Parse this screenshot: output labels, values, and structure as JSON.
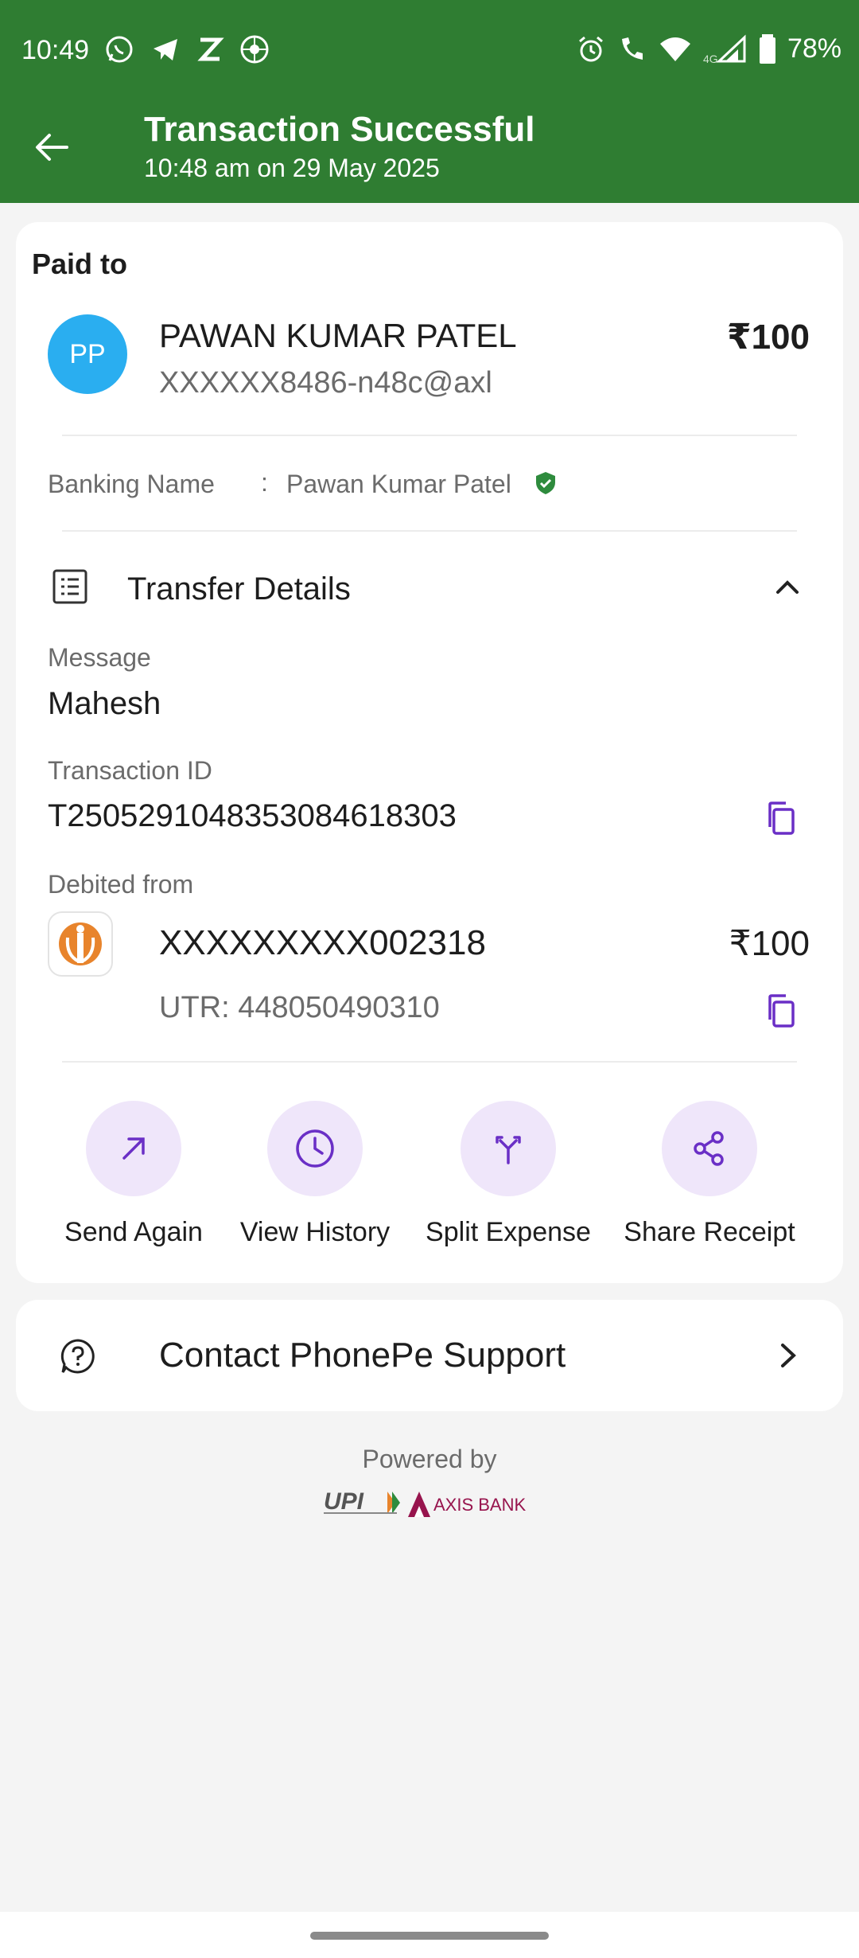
{
  "colors": {
    "header_green": "#2f7d32",
    "avatar_blue": "#2aaef0",
    "accent_purple": "#6a2fc6",
    "verified_green": "#2e8b3d"
  },
  "status_bar": {
    "time": "10:49",
    "battery": "78%",
    "network": "4G"
  },
  "header": {
    "title": "Transaction Successful",
    "subtitle": "10:48 am on 29 May 2025"
  },
  "paid_to": {
    "heading": "Paid to",
    "avatar_initials": "PP",
    "name": "PAWAN KUMAR PATEL",
    "upi_id": "XXXXXX8486-n48c@axl",
    "amount": "₹100",
    "banking_name_label": "Banking Name",
    "banking_name_sep": ":",
    "banking_name": "Pawan Kumar Patel"
  },
  "transfer_details": {
    "label": "Transfer Details",
    "message_label": "Message",
    "message": "Mahesh",
    "txn_id_label": "Transaction ID",
    "txn_id": "T2505291048353084618303",
    "debited_from_label": "Debited from",
    "account": "XXXXXXXXX002318",
    "account_amount": "₹100",
    "utr": "UTR: 448050490310"
  },
  "actions": [
    {
      "label": "Send Again",
      "icon": "arrow-up-right-icon"
    },
    {
      "label": "View History",
      "icon": "clock-icon"
    },
    {
      "label": "Split Expense",
      "icon": "split-icon"
    },
    {
      "label": "Share Receipt",
      "icon": "share-icon"
    }
  ],
  "support": {
    "label": "Contact PhonePe Support"
  },
  "footer": {
    "powered_by": "Powered by",
    "upi_logo_text": "UPI",
    "bank_logo_text": "AXIS BANK"
  }
}
